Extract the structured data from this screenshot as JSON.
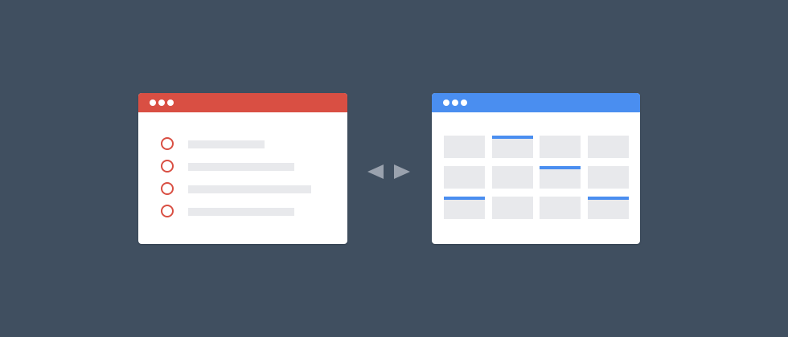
{
  "colors": {
    "background": "#404f60",
    "list_accent": "#d94f43",
    "calendar_accent": "#4a8ef0",
    "placeholder": "#e8e9ec",
    "arrow": "#9aa2ae"
  },
  "list_window": {
    "icon": "list-window-icon",
    "items": [
      {
        "icon": "circle-checkbox-icon",
        "bar_fraction": 0.45
      },
      {
        "icon": "circle-checkbox-icon",
        "bar_fraction": 0.63
      },
      {
        "icon": "circle-checkbox-icon",
        "bar_fraction": 0.73
      },
      {
        "icon": "circle-checkbox-icon",
        "bar_fraction": 0.63
      }
    ]
  },
  "calendar_window": {
    "icon": "calendar-window-icon",
    "rows": 3,
    "cols": 4,
    "event_cells": [
      [
        0,
        1
      ],
      [
        1,
        2
      ],
      [
        2,
        0
      ],
      [
        2,
        3
      ]
    ]
  },
  "sync_icon": "bidirectional-arrows-icon"
}
